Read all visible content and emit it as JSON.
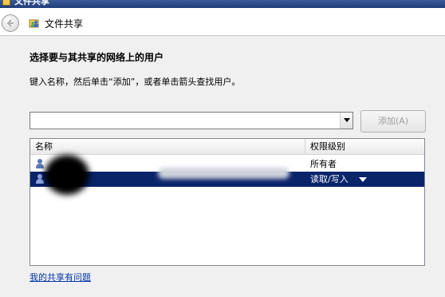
{
  "window": {
    "title": "文件共享"
  },
  "nav": {
    "back_icon": "back-arrow-icon",
    "title": "文件共享",
    "icon": "file-share-icon"
  },
  "content": {
    "heading": "选择要与其共享的网络上的用户",
    "instruction": "键入名称，然后单击“添加”，或者单击箭头查找用户。",
    "name_input": {
      "value": "",
      "placeholder": ""
    },
    "add_button": "添加(A)"
  },
  "list": {
    "columns": [
      "名称",
      "权限级别"
    ],
    "rows": [
      {
        "name": "",
        "permission": "所有者",
        "selected": false
      },
      {
        "name": "",
        "permission": "读取/写入",
        "selected": true
      }
    ]
  },
  "footer": {
    "help_link": "我的共享有问题"
  },
  "colors": {
    "selection": "#0a246a",
    "link": "#0033aa",
    "titlebar": "#1f3d78"
  }
}
